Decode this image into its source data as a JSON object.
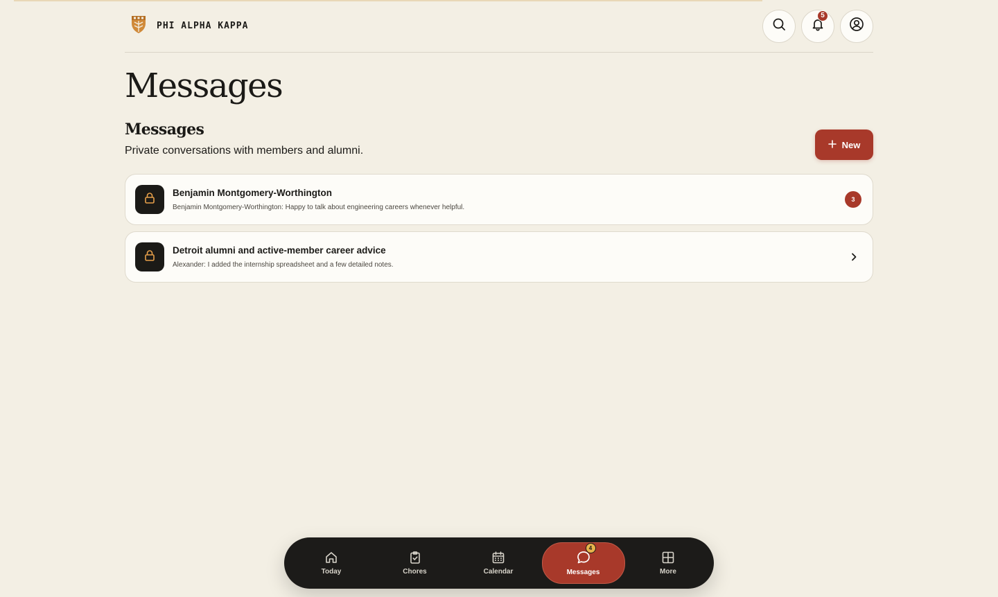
{
  "brand": {
    "name": "PHI ALPHA KAPPA",
    "logo_icon": "crest-shield-icon",
    "accent": "#d08a3a"
  },
  "header": {
    "notifications_count": "5"
  },
  "page": {
    "title": "Messages",
    "section_title": "Messages",
    "section_subtitle": "Private conversations with members and alumni.",
    "new_button_label": "New"
  },
  "conversations": [
    {
      "name": "Benjamin Montgomery-Worthington",
      "preview": "Benjamin Montgomery-Worthington: Happy to talk about engineering careers whenever helpful.",
      "unread": "3"
    },
    {
      "name": "Detroit alumni and active-member career advice",
      "preview": "Alexander: I added the internship spreadsheet and a few detailed notes.",
      "unread": null
    }
  ],
  "nav": {
    "items": [
      {
        "label": "Today",
        "icon": "home-icon"
      },
      {
        "label": "Chores",
        "icon": "clipboard-check-icon"
      },
      {
        "label": "Calendar",
        "icon": "calendar-icon"
      },
      {
        "label": "Messages",
        "icon": "chat-bubble-icon",
        "badge": "4",
        "active": true
      },
      {
        "label": "More",
        "icon": "grid-icon"
      }
    ]
  },
  "colors": {
    "background": "#f3efe4",
    "primary": "#a8392a",
    "dark": "#1b1a17",
    "badge_yellow": "#e8b34b"
  }
}
